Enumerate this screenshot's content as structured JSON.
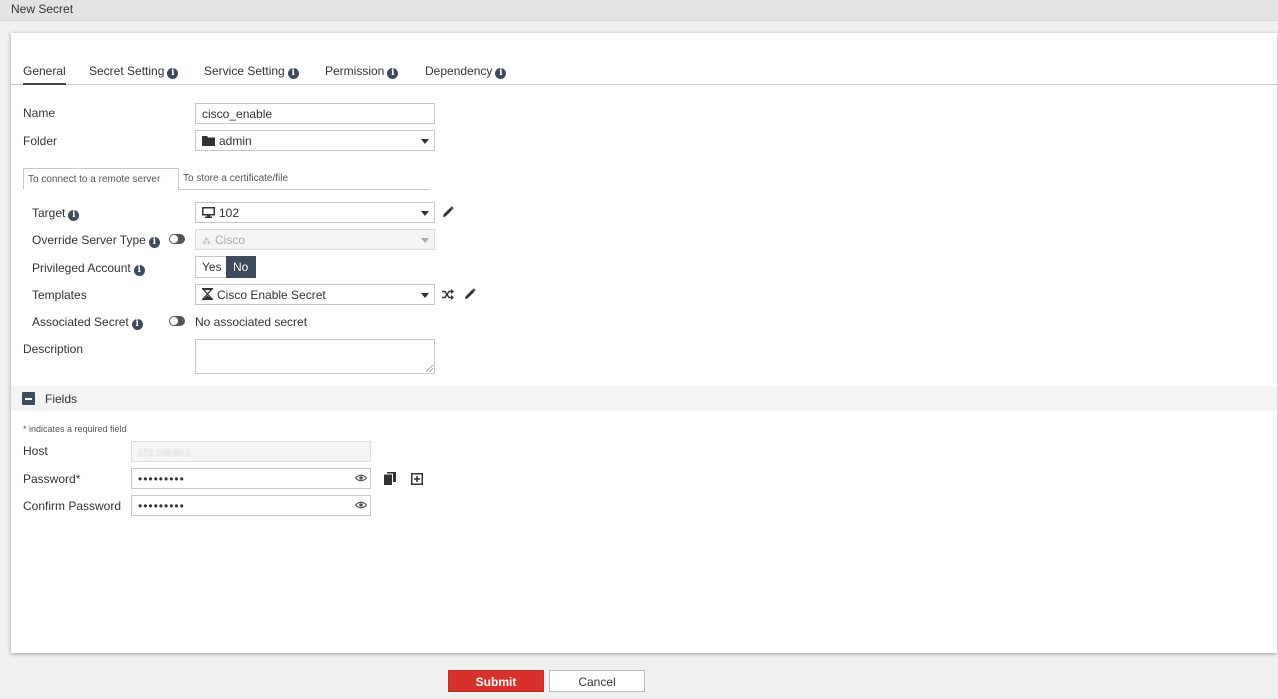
{
  "window": {
    "title": "New Secret"
  },
  "tabs": [
    {
      "label": "General",
      "active": true
    },
    {
      "label": "Secret Setting",
      "has_info": true
    },
    {
      "label": "Service Setting",
      "has_info": true
    },
    {
      "label": "Permission",
      "has_info": true
    },
    {
      "label": "Dependency",
      "has_info": true
    }
  ],
  "general": {
    "name_label": "Name",
    "name_value": "cisco_enable",
    "folder_label": "Folder",
    "folder_value": "admin",
    "subtabs": [
      "To connect to a remote server",
      "To store a certificate/file"
    ],
    "target_label": "Target",
    "target_value": "102",
    "override_label": "Override Server Type",
    "override_value": "Cisco",
    "privileged_label": "Privileged Account",
    "privileged_yes": "Yes",
    "privileged_no": "No",
    "privileged_selected": "No",
    "templates_label": "Templates",
    "templates_value": "Cisco Enable Secret",
    "associated_label": "Associated Secret",
    "associated_value": "No associated secret",
    "description_label": "Description"
  },
  "fields": {
    "section_title": "Fields",
    "required_note": "* indicates a required field",
    "host_label": "Host",
    "host_value": "172.168.90.1",
    "password_label": "Password",
    "password_required_mark": "*",
    "password_mask": "•••••••••",
    "confirm_label": "Confirm Password",
    "confirm_mask": "•••••••••"
  },
  "footer": {
    "submit_label": "Submit",
    "cancel_label": "Cancel"
  },
  "colors": {
    "accent_dark": "#3e4b5c",
    "submit_red": "#d6312a"
  }
}
